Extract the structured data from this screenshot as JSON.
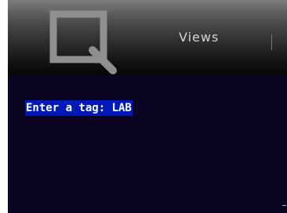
{
  "header": {
    "logo_icon": "magnifier-logo-icon",
    "nav": {
      "views_label": "Views"
    }
  },
  "main": {
    "tag_prompt": "Enter a tag: LAB"
  },
  "colors": {
    "background": "#0a0420",
    "selection": "#0019b8",
    "nav_text": "#d4d4d4"
  }
}
